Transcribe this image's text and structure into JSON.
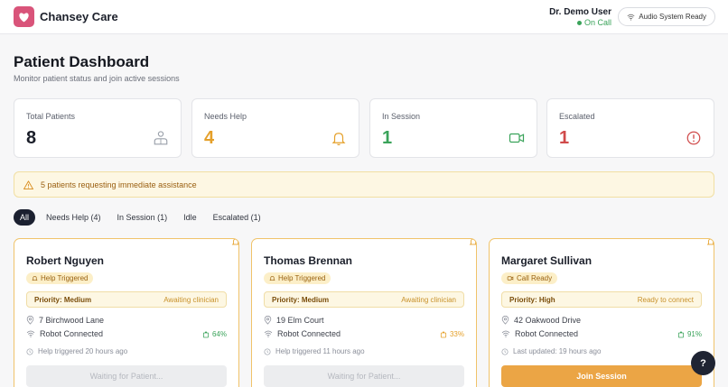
{
  "header": {
    "brand": "Chansey Care",
    "user_name": "Dr. Demo User",
    "user_status": "On Call",
    "audio_status": "Audio System Ready"
  },
  "page": {
    "title": "Patient Dashboard",
    "subtitle": "Monitor patient status and join active sessions"
  },
  "stats": [
    {
      "label": "Total Patients",
      "value": "8",
      "color": "#1b1f2a",
      "icon": "patients-icon"
    },
    {
      "label": "Needs Help",
      "value": "4",
      "color": "#e5a02a",
      "icon": "bell-icon"
    },
    {
      "label": "In Session",
      "value": "1",
      "color": "#3aa35a",
      "icon": "video-icon"
    },
    {
      "label": "Escalated",
      "value": "1",
      "color": "#d04a4a",
      "icon": "alert-circle-icon"
    }
  ],
  "alert": {
    "text": "5 patients requesting immediate assistance"
  },
  "filters": [
    {
      "label": "All",
      "active": true
    },
    {
      "label": "Needs Help (4)",
      "active": false
    },
    {
      "label": "In Session (1)",
      "active": false
    },
    {
      "label": "Idle",
      "active": false
    },
    {
      "label": "Escalated (1)",
      "active": false
    }
  ],
  "patients": [
    {
      "name": "Robert Nguyen",
      "badge": "Help Triggered",
      "priority": "Priority: Medium",
      "priority_status": "Awaiting clinician",
      "address": "7 Birchwood Lane",
      "robot": "Robot Connected",
      "battery": "64%",
      "battery_color": "#3aa35a",
      "meta": "Help triggered 20 hours ago",
      "button": "Waiting for Patient..."
    },
    {
      "name": "Thomas Brennan",
      "badge": "Help Triggered",
      "priority": "Priority: Medium",
      "priority_status": "Awaiting clinician",
      "address": "19 Elm Court",
      "robot": "Robot Connected",
      "battery": "33%",
      "battery_color": "#e5a02a",
      "meta": "Help triggered 11 hours ago",
      "button": "Waiting for Patient..."
    },
    {
      "name": "Margaret Sullivan",
      "badge": "Call Ready",
      "priority": "Priority: High",
      "priority_status": "Ready to connect",
      "address": "42 Oakwood Drive",
      "robot": "Robot Connected",
      "battery": "91%",
      "battery_color": "#3aa35a",
      "meta": "Last updated: 19 hours ago",
      "button": "Join Session"
    }
  ],
  "help_button": "?"
}
